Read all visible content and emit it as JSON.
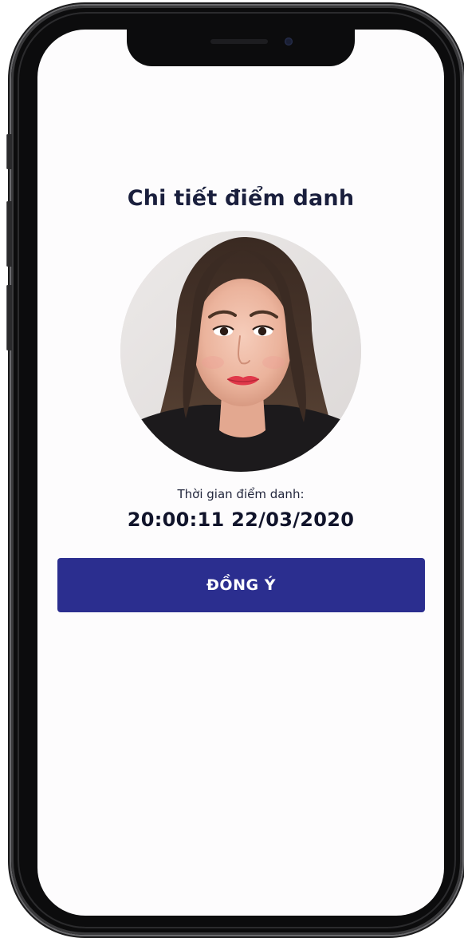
{
  "screen": {
    "title": "Chi tiết điểm danh",
    "avatar": {
      "alt": "Ảnh điểm danh"
    },
    "attendance_time": {
      "label": "Thời gian điểm danh:",
      "value": "20:00:11 22/03/2020"
    },
    "confirm_button_label": "ĐỒNG Ý"
  },
  "colors": {
    "primary_button": "#2b2e8f",
    "title_text": "#1a1f3d",
    "screen_background": "#fdfcfd",
    "phone_frame": "#0c0c0d"
  },
  "icons": {
    "phone_camera": "front-camera-icon",
    "phone_speaker": "speaker-grille-icon"
  }
}
